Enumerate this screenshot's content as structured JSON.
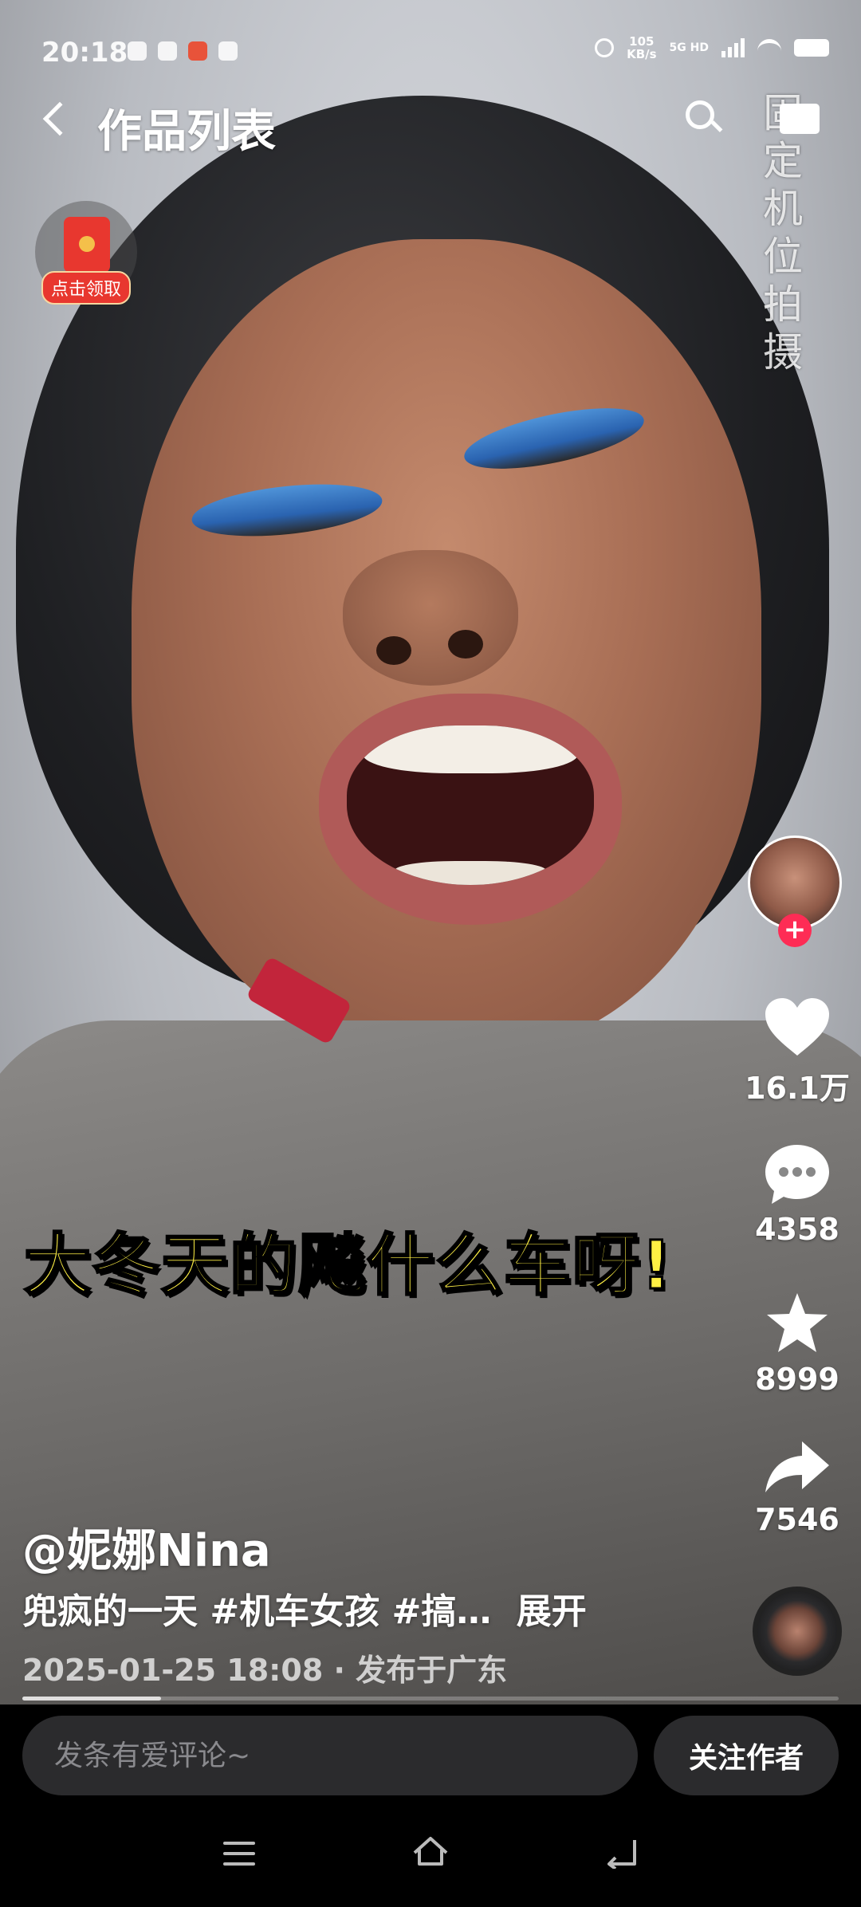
{
  "status_bar": {
    "time": "20:18",
    "net_speed_value": "105",
    "net_speed_unit": "KB/s",
    "network": "5G HD"
  },
  "nav": {
    "title": "作品列表"
  },
  "video": {
    "vertical_label": "固定机位拍摄",
    "caption": "大冬天的飚什么车呀!"
  },
  "red_packet": {
    "label": "点击领取"
  },
  "rail": {
    "likes": "16.1万",
    "comments": "4358",
    "favorites": "8999",
    "shares": "7546"
  },
  "post": {
    "author": "@妮娜Nina",
    "description": "兜疯的一天 #机车女孩 #搞…",
    "expand": "展开",
    "date": "2025-01-25 18:08",
    "location": "· 发布于广东",
    "progress": 0.17
  },
  "comment_bar": {
    "placeholder": "发条有爱评论~",
    "follow_label": "关注作者"
  },
  "colors": {
    "accent": "#fe2c55",
    "caption_yellow": "#fff044"
  }
}
